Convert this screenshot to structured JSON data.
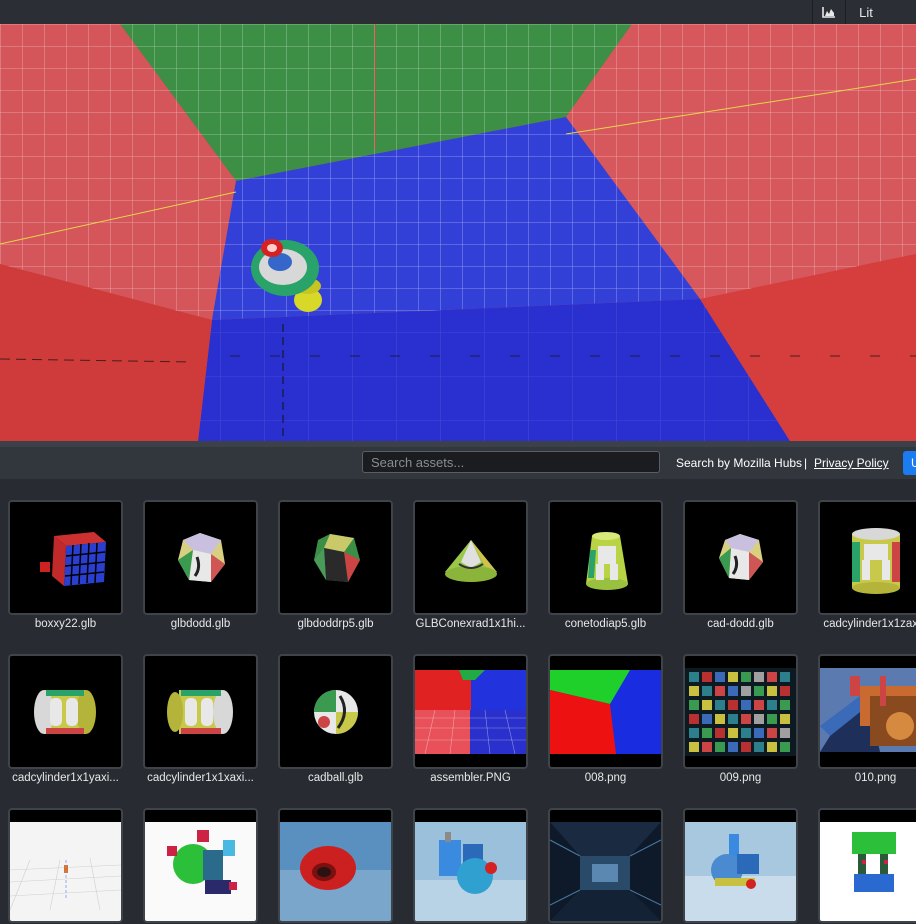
{
  "toolbar": {
    "stats_icon": "chart-area-icon",
    "render_mode": "Lit"
  },
  "search": {
    "placeholder": "Search assets...",
    "value": "",
    "search_by": "Search by Mozilla Hubs",
    "separator": "|",
    "privacy_policy": "Privacy Policy",
    "upload_label": "U"
  },
  "assets": [
    {
      "name": "boxxy22.glb"
    },
    {
      "name": "glbdodd.glb"
    },
    {
      "name": "glbdoddrp5.glb"
    },
    {
      "name": "GLBConexrad1x1hi..."
    },
    {
      "name": "conetodiap5.glb"
    },
    {
      "name": "cad-dodd.glb"
    },
    {
      "name": "cadcylinder1x1zax..."
    },
    {
      "name": "cadcylinder1x1yaxi..."
    },
    {
      "name": "cadcylinder1x1xaxi..."
    },
    {
      "name": "cadball.glb"
    },
    {
      "name": "assembler.PNG"
    },
    {
      "name": "008.png"
    },
    {
      "name": "009.png"
    },
    {
      "name": "010.png"
    }
  ]
}
